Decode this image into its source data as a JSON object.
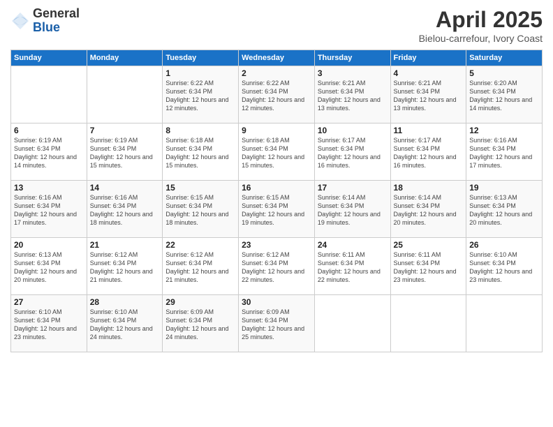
{
  "logo": {
    "general": "General",
    "blue": "Blue"
  },
  "title": "April 2025",
  "subtitle": "Bielou-carrefour, Ivory Coast",
  "days_header": [
    "Sunday",
    "Monday",
    "Tuesday",
    "Wednesday",
    "Thursday",
    "Friday",
    "Saturday"
  ],
  "weeks": [
    [
      null,
      null,
      {
        "day": 1,
        "sunrise": "6:22 AM",
        "sunset": "6:34 PM",
        "daylight": "12 hours and 12 minutes."
      },
      {
        "day": 2,
        "sunrise": "6:22 AM",
        "sunset": "6:34 PM",
        "daylight": "12 hours and 12 minutes."
      },
      {
        "day": 3,
        "sunrise": "6:21 AM",
        "sunset": "6:34 PM",
        "daylight": "12 hours and 13 minutes."
      },
      {
        "day": 4,
        "sunrise": "6:21 AM",
        "sunset": "6:34 PM",
        "daylight": "12 hours and 13 minutes."
      },
      {
        "day": 5,
        "sunrise": "6:20 AM",
        "sunset": "6:34 PM",
        "daylight": "12 hours and 14 minutes."
      }
    ],
    [
      {
        "day": 6,
        "sunrise": "6:19 AM",
        "sunset": "6:34 PM",
        "daylight": "12 hours and 14 minutes."
      },
      {
        "day": 7,
        "sunrise": "6:19 AM",
        "sunset": "6:34 PM",
        "daylight": "12 hours and 15 minutes."
      },
      {
        "day": 8,
        "sunrise": "6:18 AM",
        "sunset": "6:34 PM",
        "daylight": "12 hours and 15 minutes."
      },
      {
        "day": 9,
        "sunrise": "6:18 AM",
        "sunset": "6:34 PM",
        "daylight": "12 hours and 15 minutes."
      },
      {
        "day": 10,
        "sunrise": "6:17 AM",
        "sunset": "6:34 PM",
        "daylight": "12 hours and 16 minutes."
      },
      {
        "day": 11,
        "sunrise": "6:17 AM",
        "sunset": "6:34 PM",
        "daylight": "12 hours and 16 minutes."
      },
      {
        "day": 12,
        "sunrise": "6:16 AM",
        "sunset": "6:34 PM",
        "daylight": "12 hours and 17 minutes."
      }
    ],
    [
      {
        "day": 13,
        "sunrise": "6:16 AM",
        "sunset": "6:34 PM",
        "daylight": "12 hours and 17 minutes."
      },
      {
        "day": 14,
        "sunrise": "6:16 AM",
        "sunset": "6:34 PM",
        "daylight": "12 hours and 18 minutes."
      },
      {
        "day": 15,
        "sunrise": "6:15 AM",
        "sunset": "6:34 PM",
        "daylight": "12 hours and 18 minutes."
      },
      {
        "day": 16,
        "sunrise": "6:15 AM",
        "sunset": "6:34 PM",
        "daylight": "12 hours and 19 minutes."
      },
      {
        "day": 17,
        "sunrise": "6:14 AM",
        "sunset": "6:34 PM",
        "daylight": "12 hours and 19 minutes."
      },
      {
        "day": 18,
        "sunrise": "6:14 AM",
        "sunset": "6:34 PM",
        "daylight": "12 hours and 20 minutes."
      },
      {
        "day": 19,
        "sunrise": "6:13 AM",
        "sunset": "6:34 PM",
        "daylight": "12 hours and 20 minutes."
      }
    ],
    [
      {
        "day": 20,
        "sunrise": "6:13 AM",
        "sunset": "6:34 PM",
        "daylight": "12 hours and 20 minutes."
      },
      {
        "day": 21,
        "sunrise": "6:12 AM",
        "sunset": "6:34 PM",
        "daylight": "12 hours and 21 minutes."
      },
      {
        "day": 22,
        "sunrise": "6:12 AM",
        "sunset": "6:34 PM",
        "daylight": "12 hours and 21 minutes."
      },
      {
        "day": 23,
        "sunrise": "6:12 AM",
        "sunset": "6:34 PM",
        "daylight": "12 hours and 22 minutes."
      },
      {
        "day": 24,
        "sunrise": "6:11 AM",
        "sunset": "6:34 PM",
        "daylight": "12 hours and 22 minutes."
      },
      {
        "day": 25,
        "sunrise": "6:11 AM",
        "sunset": "6:34 PM",
        "daylight": "12 hours and 23 minutes."
      },
      {
        "day": 26,
        "sunrise": "6:10 AM",
        "sunset": "6:34 PM",
        "daylight": "12 hours and 23 minutes."
      }
    ],
    [
      {
        "day": 27,
        "sunrise": "6:10 AM",
        "sunset": "6:34 PM",
        "daylight": "12 hours and 23 minutes."
      },
      {
        "day": 28,
        "sunrise": "6:10 AM",
        "sunset": "6:34 PM",
        "daylight": "12 hours and 24 minutes."
      },
      {
        "day": 29,
        "sunrise": "6:09 AM",
        "sunset": "6:34 PM",
        "daylight": "12 hours and 24 minutes."
      },
      {
        "day": 30,
        "sunrise": "6:09 AM",
        "sunset": "6:34 PM",
        "daylight": "12 hours and 25 minutes."
      },
      null,
      null,
      null
    ]
  ]
}
